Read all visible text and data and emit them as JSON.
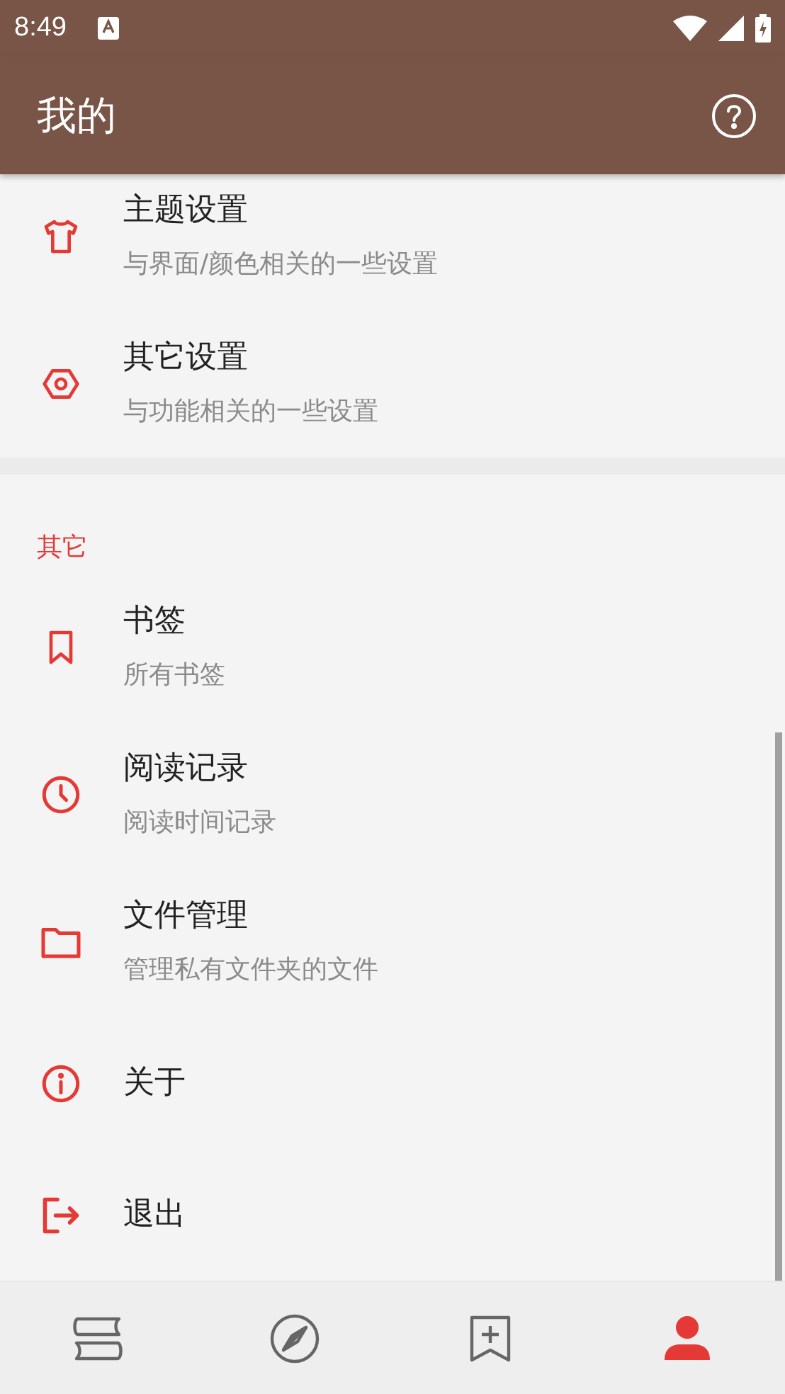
{
  "status_bar": {
    "time": "8:49"
  },
  "app_bar": {
    "title": "我的"
  },
  "settings": [
    {
      "title": "主题设置",
      "subtitle": "与界面/颜色相关的一些设置"
    },
    {
      "title": "其它设置",
      "subtitle": "与功能相关的一些设置"
    }
  ],
  "other_section": {
    "header": "其它",
    "items": [
      {
        "title": "书签",
        "subtitle": "所有书签"
      },
      {
        "title": "阅读记录",
        "subtitle": "阅读时间记录"
      },
      {
        "title": "文件管理",
        "subtitle": "管理私有文件夹的文件"
      },
      {
        "title": "关于"
      },
      {
        "title": "退出"
      }
    ]
  },
  "bottom_nav": [
    {
      "selected": false
    },
    {
      "selected": false
    },
    {
      "selected": false
    },
    {
      "selected": true
    }
  ]
}
